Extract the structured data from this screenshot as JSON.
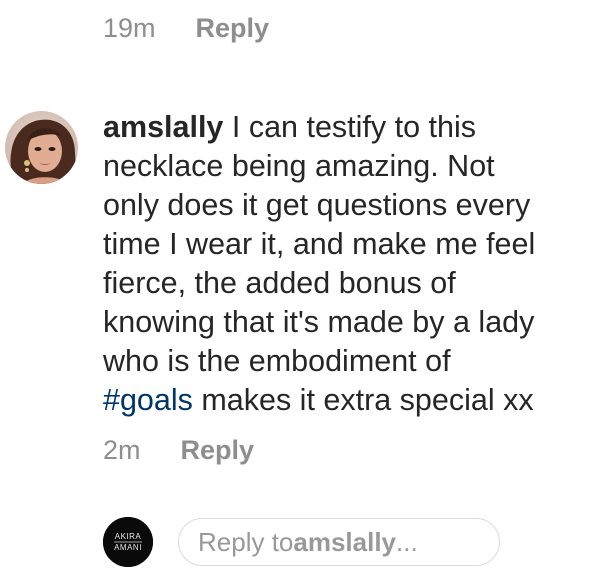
{
  "previous_comment": {
    "time": "19m",
    "reply_label": "Reply"
  },
  "comment": {
    "username": "amslally",
    "lines": [
      "I can testify to this",
      "necklace being amazing. Not",
      "only does it get questions every",
      "time I wear it, and make me feel",
      "fierce, the added bonus of",
      "knowing that it's made by a lady",
      "who is the embodiment of"
    ],
    "hashtag": "#goals",
    "last_line_rest": " makes it extra special xx",
    "time": "2m",
    "reply_label": "Reply"
  },
  "reply_bar": {
    "brand_logo_text": [
      "AKIRA",
      "AMANI"
    ],
    "placeholder_prefix": "Reply to ",
    "placeholder_user": "amslally",
    "placeholder_suffix": "..."
  },
  "colors": {
    "text": "#262626",
    "muted": "#8e8e8e",
    "hashtag": "#003569",
    "border": "#dbdbdb"
  }
}
